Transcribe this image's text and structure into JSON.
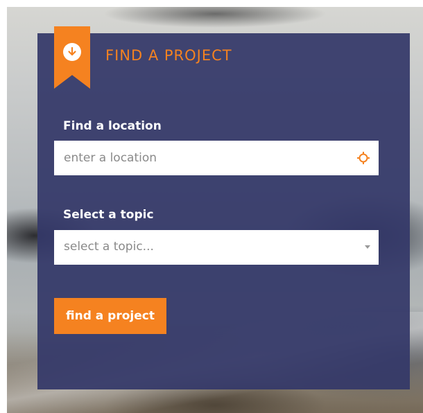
{
  "widget": {
    "title": "FIND A PROJECT",
    "badge_icon": "arrow-down-circle-icon",
    "accent_color": "#f58220",
    "panel_color": "#343868"
  },
  "location": {
    "label": "Find a location",
    "placeholder": "enter a location",
    "value": "",
    "locate_icon": "crosshair-icon"
  },
  "topic": {
    "label": "Select a topic",
    "selected": "select a topic...",
    "caret_icon": "caret-down-icon"
  },
  "action": {
    "submit_label": "find a project"
  }
}
